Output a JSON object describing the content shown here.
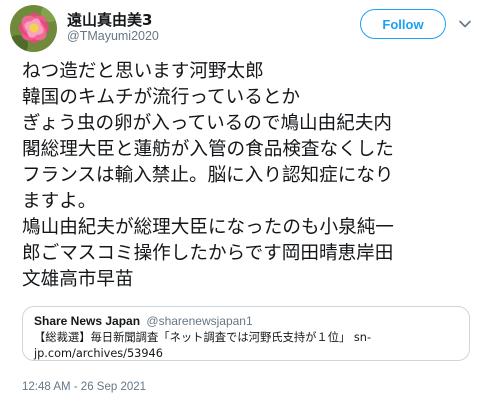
{
  "author": {
    "display_name": "遠山真由美3",
    "handle": "@TMayumi2020",
    "avatar_icon": "pink-flower-avatar"
  },
  "follow_button": {
    "label": "Follow"
  },
  "more_menu_icon": "chevron-down-icon",
  "tweet": {
    "text": "ねつ造だと思います河野太郎\n韓国のキムチが流行っているとか\nぎょう虫の卵が入っているので鳩山由紀夫内\n閣総理大臣と蓮舫が入管の食品検査なくした\nフランスは輸入禁止。脳に入り認知症になり\nますよ。\n鳩山由紀夫が総理大臣になったのも小泉純一\n郎ごマスコミ操作したからです岡田晴恵岸田\n文雄高市早苗",
    "timestamp": "12:48 AM - 26 Sep 2021"
  },
  "quoted_tweet": {
    "name": "Share News Japan",
    "handle": "@sharenewsjapan1",
    "text": "【総裁選】毎日新聞調査「ネット調査では河野氏支持が１位」 sn-jp.com/archives/53946"
  },
  "colors": {
    "accent": "#1da1f2",
    "text": "#14171a",
    "secondary_text": "#657786",
    "border": "#ccd6dd"
  }
}
